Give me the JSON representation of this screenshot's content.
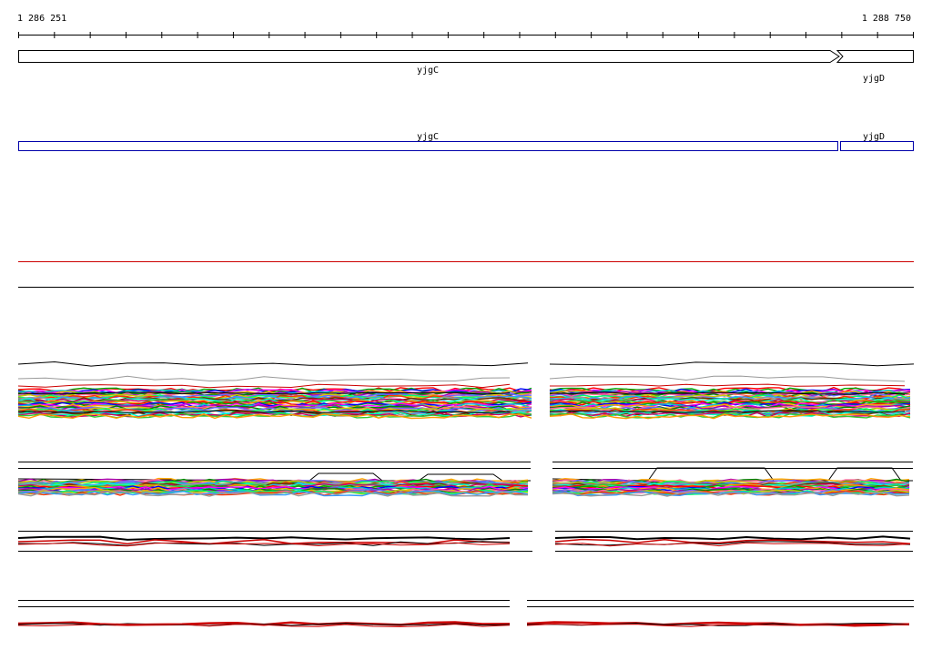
{
  "ruler": {
    "start_label": "1 286 251",
    "end_label": "1 288 750",
    "start": 1286251,
    "end": 1288750,
    "tick_count": 26
  },
  "genes": [
    {
      "name": "yjgC",
      "start": 1286251,
      "end": 1288551,
      "strand": "+"
    },
    {
      "name": "yjgD",
      "start": 1288551,
      "end": 1288750,
      "strand": "+"
    }
  ],
  "transcripts": [
    {
      "name": "yjgC",
      "start": 1286251,
      "end": 1288551
    },
    {
      "name": "yjgD",
      "start": 1288551,
      "end": 1288750
    }
  ],
  "colors": {
    "gene_outline": "#000000",
    "transcript_outline": "#0000aa",
    "track_red": "#cc0000",
    "track_black": "#000000"
  },
  "tracks": {
    "panel_a_series_count": 40,
    "panel_b_series_count": 30,
    "panel_c_series_count": 4,
    "panel_d_series_count": 3
  }
}
